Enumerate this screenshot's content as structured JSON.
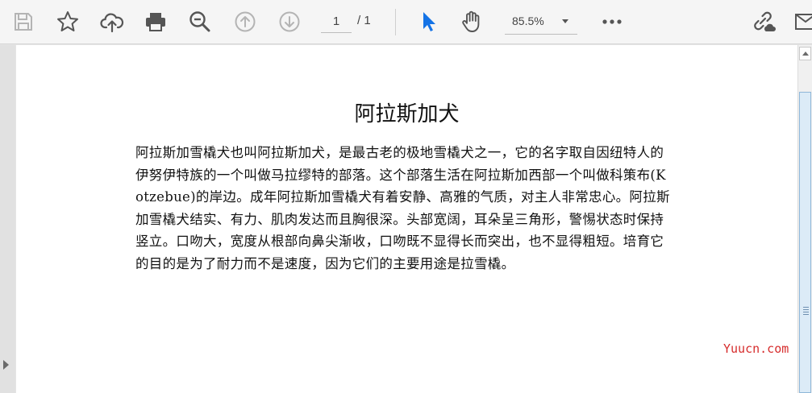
{
  "toolbar": {
    "icons": [
      "save-icon",
      "bookmark-star-icon",
      "cloud-upload-icon",
      "print-icon",
      "zoom-out-icon",
      "previous-page-icon",
      "next-page-icon",
      "select-cursor-icon",
      "hand-pan-icon",
      "more-options-icon",
      "share-link-icon",
      "sign-icon"
    ],
    "page_current": "1",
    "page_total": "/ 1",
    "zoom_value": "85.5%"
  },
  "document": {
    "title": "阿拉斯加犬",
    "body": "阿拉斯加雪橇犬也叫阿拉斯加犬，是最古老的极地雪橇犬之一，它的名字取自因纽特人的伊努伊特族的一个叫做马拉缪特的部落。这个部落生活在阿拉斯加西部一个叫做科策布(Kotzebue)的岸边。成年阿拉斯加雪橇犬有着安静、高雅的气质，对主人非常忠心。阿拉斯加雪橇犬结实、有力、肌肉发达而且胸很深。头部宽阔，耳朵呈三角形，警惕状态时保持竖立。口吻大，宽度从根部向鼻尖渐收，口吻既不显得长而突出，也不显得粗短。培育它的目的是为了耐力而不是速度，因为它们的主要用途是拉雪橇。"
  },
  "watermark": "Yuucn.com",
  "colors": {
    "accent_blue": "#1473e6",
    "icon_gray": "#5c5c5c",
    "disabled_gray": "#b4b4b4",
    "watermark_red": "#d62c2c"
  }
}
